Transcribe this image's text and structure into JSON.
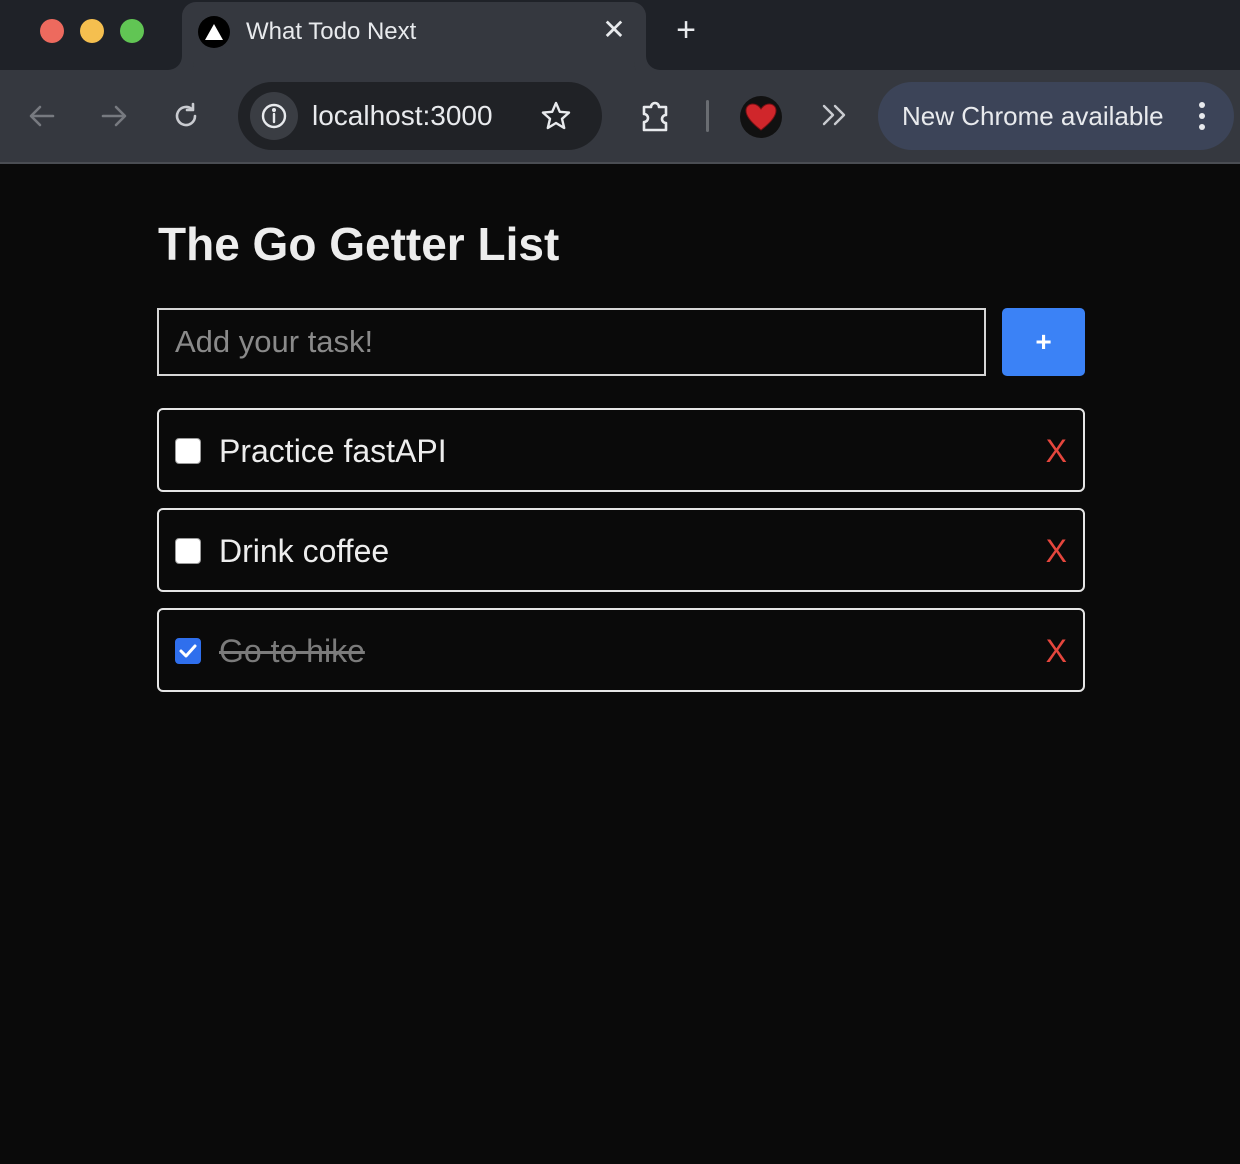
{
  "browser": {
    "tab": {
      "title": "What Todo Next",
      "close_glyph": "✕"
    },
    "new_tab_glyph": "+",
    "address": {
      "url": "localhost:3000"
    },
    "update_notice": "New Chrome available"
  },
  "app": {
    "title": "The Go Getter List",
    "input": {
      "placeholder": "Add your task!",
      "value": ""
    },
    "add_button_label": "+",
    "todos": [
      {
        "text": "Practice fastAPI",
        "done": false,
        "delete_label": "X"
      },
      {
        "text": "Drink coffee",
        "done": false,
        "delete_label": "X"
      },
      {
        "text": "Go to hike",
        "done": true,
        "delete_label": "X"
      }
    ]
  },
  "colors": {
    "accent": "#3b82f6",
    "delete": "#e5463d",
    "page_bg": "#0a0a0a",
    "chrome_update_pill": "#3c4458"
  },
  "icons": [
    "nextjs-triangle-icon",
    "arrow-left-icon",
    "arrow-right-icon",
    "reload-icon",
    "info-icon",
    "star-icon",
    "puzzle-icon",
    "heart-icon",
    "double-chevron-icon",
    "kebab-icon"
  ]
}
